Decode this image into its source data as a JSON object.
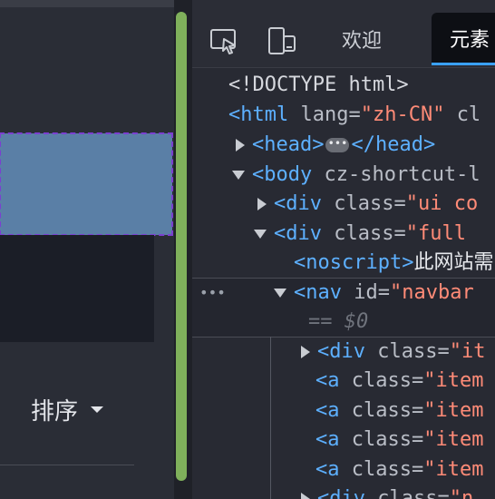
{
  "page": {
    "sort_label": "排序"
  },
  "devtools": {
    "tabs": {
      "welcome": "欢迎",
      "elements": "元素"
    },
    "icons": [
      "inspect-icon",
      "device-toolbar-icon"
    ],
    "accent": "#3aa0ff",
    "tree": {
      "doctype": "<!DOCTYPE html>",
      "html_open": "<html",
      "html_attr": "lang=",
      "html_val": "\"zh-CN\"",
      "html_tail": "cl",
      "head_open": "<head>",
      "head_close": "</head>",
      "body_open": "<body",
      "body_attr": "cz-shortcut-l",
      "div1_open": "<div",
      "div1_attr": "class=",
      "div1_val": "\"ui co",
      "div2_open": "<div",
      "div2_attr": "class=",
      "div2_val": "\"full",
      "noscript_open": "<noscript>",
      "noscript_text": "此网站需",
      "nav_open": "<nav",
      "nav_attr": "id=",
      "nav_val": "\"navbar",
      "dollar0": "== $0",
      "div3_open": "<div",
      "div3_attr": "class=",
      "div3_val": "\"it",
      "a_open": "<a",
      "a_attr": "class=",
      "a_val": "\"item",
      "last_open": "<div",
      "last_attr": "class=",
      "last_val": "\"n"
    }
  }
}
